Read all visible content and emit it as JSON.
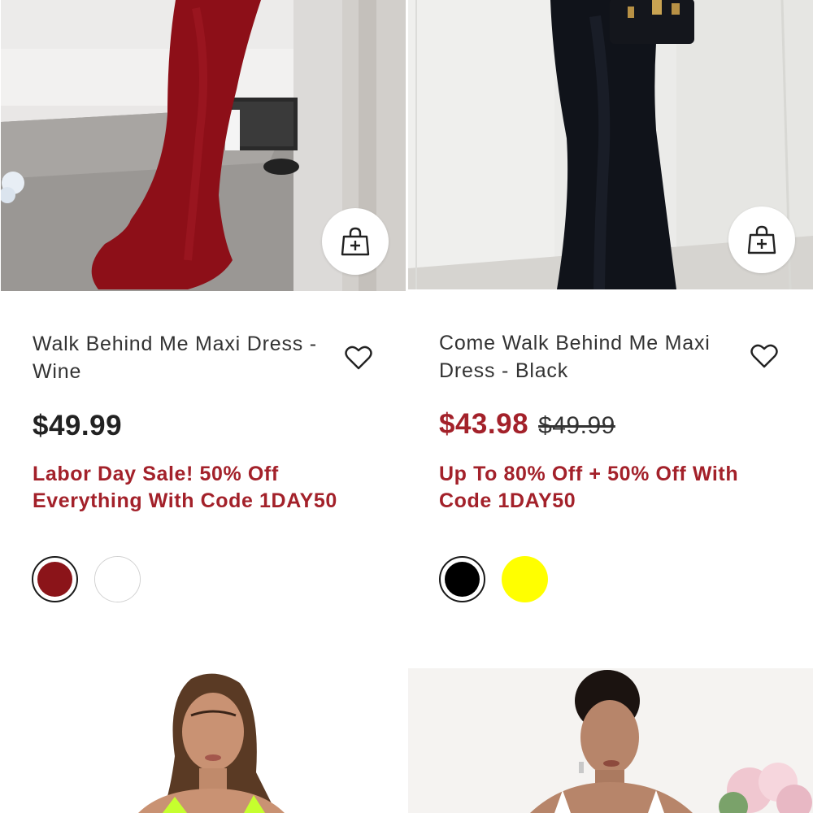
{
  "products": [
    {
      "title": "Walk Behind Me Maxi Dress - Wine",
      "price": "$49.99",
      "promo": "Labor Day Sale! 50% Off Everything With Code 1DAY50",
      "swatches": [
        {
          "color": "#8b1419",
          "selected": true
        },
        {
          "color": "#ffffff",
          "selected": false
        }
      ]
    },
    {
      "title": "Come Walk Behind Me Maxi Dress - Black",
      "sale_price": "$43.98",
      "original_price": "$49.99",
      "promo": "Up To 80% Off + 50% Off With Code 1DAY50",
      "swatches": [
        {
          "color": "#000000",
          "selected": true
        },
        {
          "color": "#ffff00",
          "selected": false
        }
      ]
    }
  ],
  "icons": {
    "add_to_bag": "bag-plus-icon",
    "wishlist": "heart-outline-icon"
  },
  "colors": {
    "accent": "#a3212a",
    "text": "#333333"
  }
}
